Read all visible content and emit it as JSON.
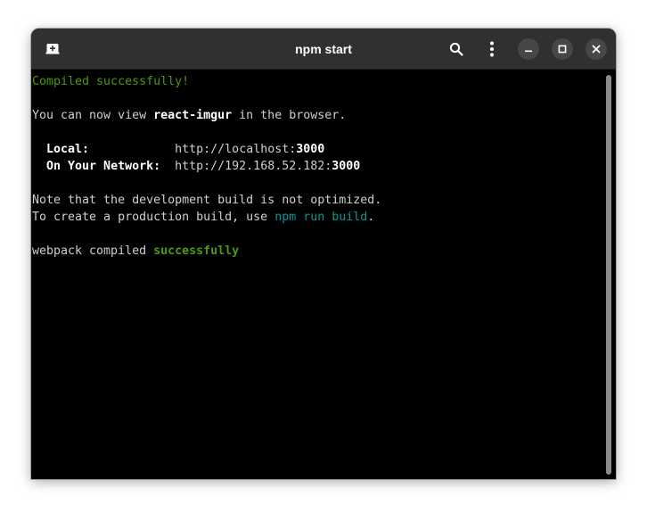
{
  "window": {
    "title": "npm start"
  },
  "icons": {
    "new_tab": "new-tab-icon",
    "search": "search-icon",
    "menu": "kebab-menu-icon",
    "minimize": "minimize-icon",
    "maximize": "maximize-icon",
    "close": "close-icon"
  },
  "colors": {
    "titlebar": "#303030",
    "terminal_bg": "#000000",
    "text": "#d0cfcc",
    "success_green": "#4e9a06",
    "command_cyan": "#06989a"
  },
  "terminal": {
    "compiled": "Compiled successfully!",
    "view_prefix": "You can now view ",
    "app_name": "react-imgur",
    "view_suffix": " in the browser.",
    "local_label": "Local:",
    "local_url_prefix": "http://localhost:",
    "local_port": "3000",
    "network_label": "On Your Network:",
    "network_url_prefix": "http://192.168.52.182:",
    "network_port": "3000",
    "note": "Note that the development build is not optimized.",
    "prod_prefix": "To create a production build, use ",
    "prod_command": "npm run build",
    "prod_suffix": ".",
    "webpack_prefix": "webpack compiled ",
    "webpack_status": "successfully"
  }
}
